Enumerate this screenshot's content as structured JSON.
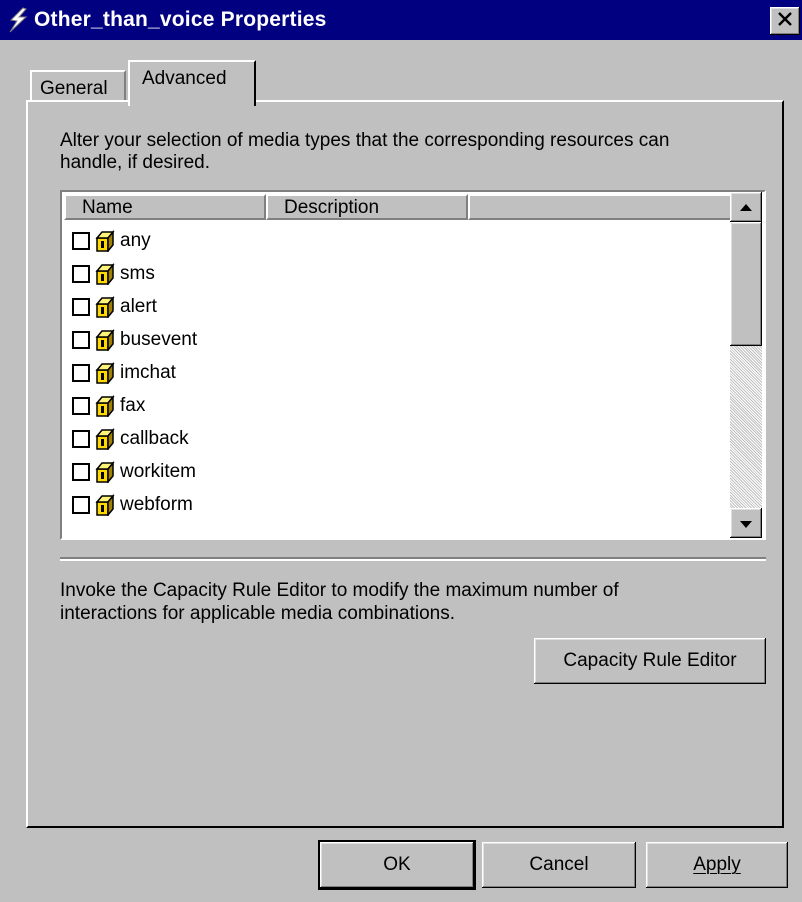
{
  "window": {
    "title": "Other_than_voice Properties",
    "title_icon": "lightning-icon",
    "close_icon": "close-icon"
  },
  "tabs": [
    {
      "label": "General",
      "selected": false
    },
    {
      "label": "Advanced",
      "selected": true
    }
  ],
  "advanced": {
    "media_description_line1": "Alter your selection of media types that the corresponding resources can",
    "media_description_line2": "handle, if desired.",
    "list": {
      "columns": [
        "Name",
        "Description",
        ""
      ],
      "items": [
        {
          "name": "any",
          "checked": false,
          "icon": "media-type-icon"
        },
        {
          "name": "sms",
          "checked": false,
          "icon": "media-type-icon"
        },
        {
          "name": "alert",
          "checked": false,
          "icon": "media-type-icon"
        },
        {
          "name": "busevent",
          "checked": false,
          "icon": "media-type-icon"
        },
        {
          "name": "imchat",
          "checked": false,
          "icon": "media-type-icon"
        },
        {
          "name": "fax",
          "checked": false,
          "icon": "media-type-icon"
        },
        {
          "name": "callback",
          "checked": false,
          "icon": "media-type-icon"
        },
        {
          "name": "workitem",
          "checked": false,
          "icon": "media-type-icon"
        },
        {
          "name": "webform",
          "checked": false,
          "icon": "media-type-icon"
        }
      ]
    },
    "capacity_description_line1": "Invoke the Capacity Rule Editor to modify the maximum number of",
    "capacity_description_line2": "interactions for applicable media combinations.",
    "capacity_button": "Capacity Rule Editor"
  },
  "buttons": {
    "ok": "OK",
    "cancel": "Cancel",
    "apply": "Apply"
  },
  "colors": {
    "titlebar": "#000080",
    "face": "#c0c0c0",
    "icon_yellow": "#ffd800"
  }
}
